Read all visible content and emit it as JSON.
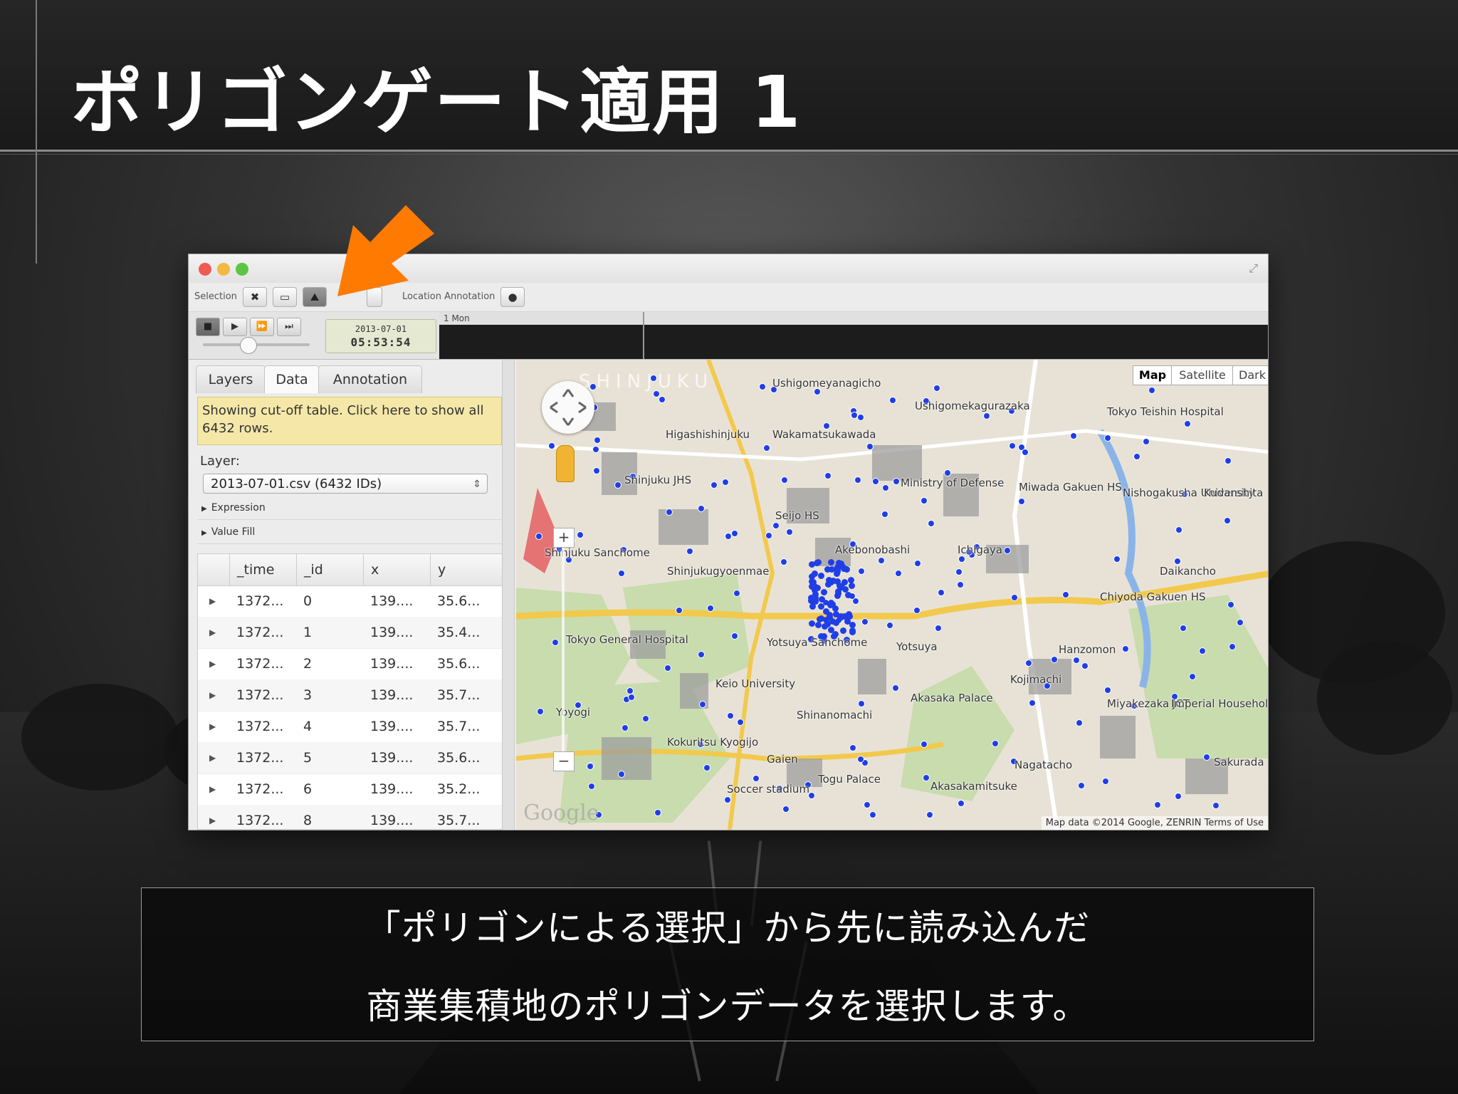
{
  "slide": {
    "title": "ポリゴンゲート適用 1",
    "caption_line1": "「ポリゴンによる選択」から先に読み込んだ",
    "caption_line2": "商業集積地のポリゴンデータを選択します。"
  },
  "toolbar": {
    "selection_label": "Selection",
    "location_annotation_label": "Location Annotation",
    "clear_selection_icon": "close-icon",
    "rect_selection_icon": "rectangle-select-icon",
    "polygon_selection_icon": "polygon-select-icon",
    "pin_icon": "pin-icon"
  },
  "playback": {
    "date": "2013-07-01",
    "time": "05:53:54",
    "timeline_label": "1 Mon"
  },
  "sidebar": {
    "tabs": [
      {
        "label": "Layers"
      },
      {
        "label": "Data"
      },
      {
        "label": "Annotation"
      }
    ],
    "notice": "Showing cut-off table. Click here to show all 6432 rows.",
    "layer_label": "Layer:",
    "layer_value": "2013-07-01.csv (6432 IDs)",
    "expression_label": "Expression",
    "value_fill_label": "Value Fill"
  },
  "table": {
    "columns": [
      "_time",
      "_id",
      "x",
      "y"
    ],
    "rows": [
      [
        "1372...",
        "0",
        "139....",
        "35.6..."
      ],
      [
        "1372...",
        "1",
        "139....",
        "35.4..."
      ],
      [
        "1372...",
        "2",
        "139....",
        "35.6..."
      ],
      [
        "1372...",
        "3",
        "139....",
        "35.7..."
      ],
      [
        "1372...",
        "4",
        "139....",
        "35.7..."
      ],
      [
        "1372...",
        "5",
        "139....",
        "35.6..."
      ],
      [
        "1372...",
        "6",
        "139....",
        "35.2..."
      ],
      [
        "1372...",
        "8",
        "139....",
        "35.7..."
      ]
    ]
  },
  "map": {
    "types": [
      "Map",
      "Satellite",
      "Dark"
    ],
    "active_type": "Map",
    "attribution": "Map data ©2014 Google, ZENRIN   Terms of Use",
    "logo": "Google",
    "area_label": "SHINJUKU",
    "places": [
      "Ushigomeyanagicho",
      "Ushigomekagurazaka",
      "Higashishinjuku",
      "Wakamatsukawada",
      "Shinjuku JHS",
      "Ministry of Defense",
      "Seijo HS",
      "Miwada Gakuen HS",
      "Nishogakusha University",
      "Kudanshita",
      "Shinjuku Sanchome",
      "Shinjukugyoenmae",
      "Akebonobashi",
      "Ichigaya",
      "Daikancho",
      "Chiyoda Gakuen HS",
      "Yotsuya Sanchome",
      "Yotsuya",
      "Hanzomon",
      "Tokyo General Hospital",
      "Keio University",
      "Kojimachi",
      "Yoyogi",
      "Shinanomachi",
      "Akasaka Palace",
      "Kokuritsu Kyogijo",
      "Gaien",
      "Togu Palace",
      "Nagatacho",
      "Akasakamitsuke",
      "Soccer stadium",
      "Miyakezaka JCT",
      "Imperial Household Agency",
      "Sakurada",
      "Tokyo Teishin Hospital"
    ],
    "colors": {
      "land": "#e8e2d6",
      "park": "#c8dcae",
      "highway": "#f2c94c",
      "river": "#8ab4e8",
      "points": "#1f3ee8"
    }
  },
  "annotation_arrow_color": "#ff7a00"
}
